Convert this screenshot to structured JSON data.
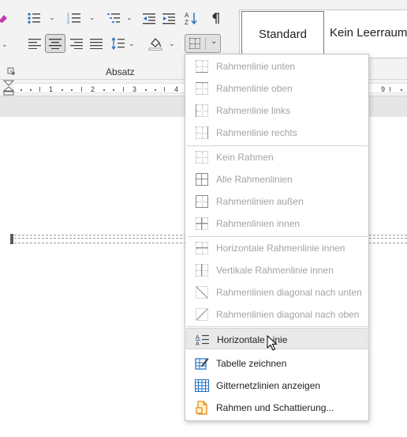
{
  "ribbon": {
    "group_label": "Absatz",
    "styles": {
      "standard": "Standard",
      "kein_leerraum": "Kein Leerraum"
    }
  },
  "ruler": {
    "numbers": [
      "1",
      "2",
      "3",
      "4",
      "9"
    ]
  },
  "borders_menu": {
    "items": [
      {
        "label": "Rahmenlinie unten",
        "enabled": false,
        "icon": "border-bottom-icon"
      },
      {
        "label": "Rahmenlinie oben",
        "enabled": false,
        "icon": "border-top-icon"
      },
      {
        "label": "Rahmenlinie links",
        "enabled": false,
        "icon": "border-left-icon"
      },
      {
        "label": "Rahmenlinie rechts",
        "enabled": false,
        "icon": "border-right-icon"
      },
      {
        "label": "Kein Rahmen",
        "enabled": false,
        "icon": "no-border-icon"
      },
      {
        "label": "Alle Rahmenlinien",
        "enabled": false,
        "icon": "all-borders-icon"
      },
      {
        "label": "Rahmenlinien außen",
        "enabled": false,
        "icon": "outside-borders-icon"
      },
      {
        "label": "Rahmenlinien innen",
        "enabled": false,
        "icon": "inside-borders-icon"
      },
      {
        "label": "Horizontale Rahmenlinie innen",
        "enabled": false,
        "icon": "inside-horizontal-border-icon"
      },
      {
        "label": "Vertikale Rahmenlinie innen",
        "enabled": false,
        "icon": "inside-vertical-border-icon"
      },
      {
        "label": "Rahmenlinien diagonal nach unten",
        "enabled": false,
        "icon": "diagonal-down-border-icon"
      },
      {
        "label": "Rahmenlinien diagonal nach oben",
        "enabled": false,
        "icon": "diagonal-up-border-icon"
      },
      {
        "label": "Horizontale Linie",
        "enabled": true,
        "icon": "horizontal-line-icon",
        "hovered": true
      },
      {
        "label": "Tabelle zeichnen",
        "enabled": true,
        "icon": "draw-table-icon"
      },
      {
        "label": "Gitternetzlinien anzeigen",
        "enabled": true,
        "icon": "view-gridlines-icon"
      },
      {
        "label": "Rahmen und Schattierung...",
        "enabled": true,
        "icon": "borders-shading-icon"
      }
    ]
  },
  "colors": {
    "accent": "#1e6fc2",
    "disabled_text": "#a3a3a3",
    "menu_hover": "#e9e9e9",
    "ribbon_bg": "#f3f3f3"
  }
}
